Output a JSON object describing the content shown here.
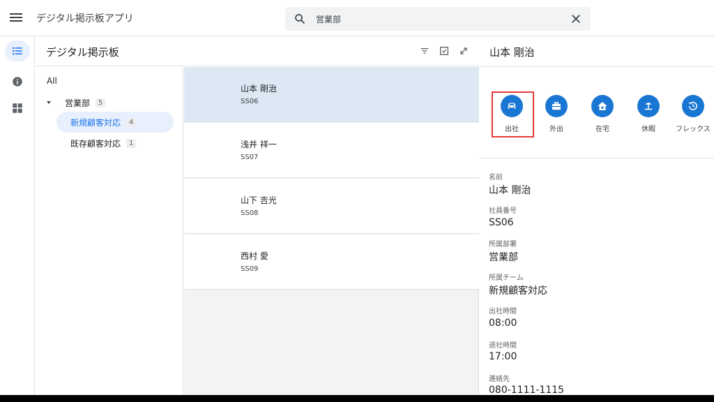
{
  "app": {
    "title": "デジタル掲示板アプリ"
  },
  "search": {
    "value": "営業部"
  },
  "panel": {
    "title": "デジタル掲示板"
  },
  "tree": {
    "all_label": "All",
    "group": {
      "label": "営業部",
      "count": "5"
    },
    "children": [
      {
        "label": "新規顧客対応",
        "count": "4"
      },
      {
        "label": "既存顧客対応",
        "count": "1"
      }
    ]
  },
  "members": [
    {
      "name": "山本 剛治",
      "code": "SS06"
    },
    {
      "name": "浅井 祥一",
      "code": "SS07"
    },
    {
      "name": "山下 吉光",
      "code": "SS08"
    },
    {
      "name": "西村 愛",
      "code": "SS09"
    }
  ],
  "detail": {
    "title": "山本 剛治",
    "statuses": [
      {
        "label": "出社",
        "icon": "car-icon"
      },
      {
        "label": "外出",
        "icon": "briefcase-icon"
      },
      {
        "label": "在宅",
        "icon": "home-icon"
      },
      {
        "label": "休暇",
        "icon": "beach-icon"
      },
      {
        "label": "フレックス",
        "icon": "history-icon"
      }
    ],
    "fields": [
      {
        "label": "名前",
        "value": "山本 剛治"
      },
      {
        "label": "社員番号",
        "value": "SS06"
      },
      {
        "label": "所属部署",
        "value": "営業部"
      },
      {
        "label": "所属チーム",
        "value": "新規顧客対応"
      },
      {
        "label": "出社時間",
        "value": "08:00"
      },
      {
        "label": "退社時間",
        "value": "17:00"
      },
      {
        "label": "連絡先",
        "value": "080-1111-1115"
      }
    ]
  },
  "colors": {
    "accent": "#1976d2",
    "selected_bg": "#dde8f4",
    "highlight": "#e53935"
  }
}
